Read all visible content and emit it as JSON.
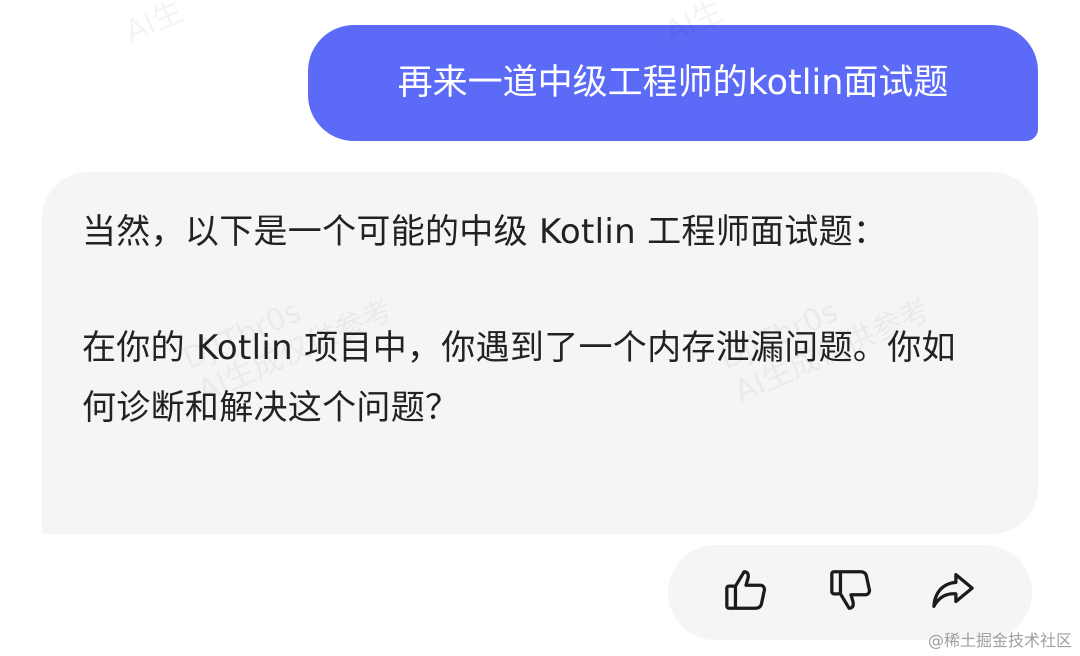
{
  "watermark": {
    "top_left": "AI生",
    "top_right": "AI生",
    "mid_left": "DjITbr0s\nAI生成仅供参考",
    "mid_right": "DjITbr0s\nAI生成仅供参考"
  },
  "chat": {
    "user_message": "再来一道中级工程师的kotlin面试题",
    "ai_paragraphs": [
      "当然，以下是一个可能的中级 Kotlin 工程师面试题：",
      "在你的 Kotlin 项目中，你遇到了一个内存泄漏问题。你如何诊断和解决这个问题？"
    ]
  },
  "actions": {
    "like_icon": "thumbs-up-icon",
    "dislike_icon": "thumbs-down-icon",
    "share_icon": "share-icon"
  },
  "site_watermark": "@稀土掘金技术社区",
  "colors": {
    "user_bubble": "#5b6bf8",
    "ai_bubble": "#f5f5f7",
    "icon_stroke": "#1b1b1b"
  }
}
